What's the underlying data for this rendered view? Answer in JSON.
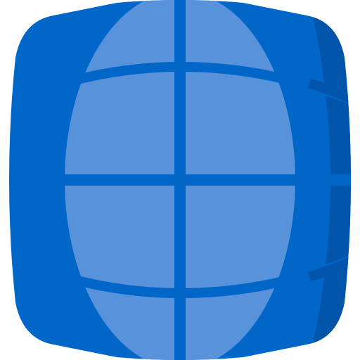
{
  "icon": {
    "name": "globe-grid-icon",
    "colors": {
      "base": "#0066C8",
      "highlight": "#5892DA",
      "shade": "#0055AA",
      "grid": "#0066C8",
      "background": "#FFFFFF"
    }
  }
}
